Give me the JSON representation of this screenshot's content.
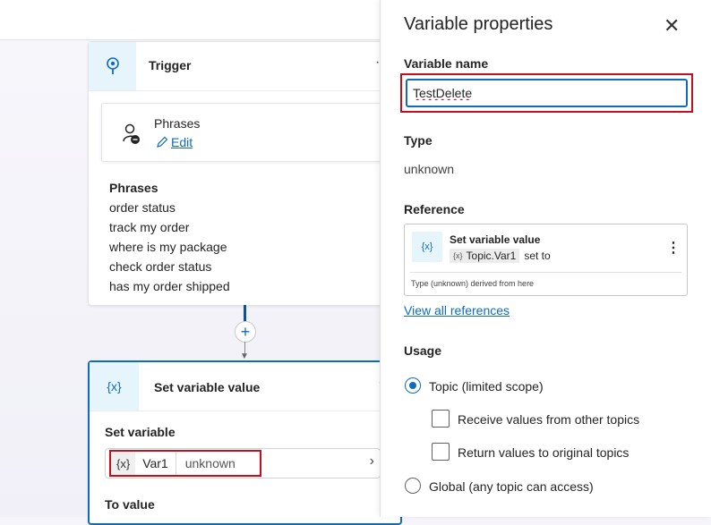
{
  "canvas": {
    "trigger": {
      "title": "Trigger",
      "more": "···",
      "phrases_box": {
        "title": "Phrases",
        "edit_label": "Edit"
      },
      "phrases_title": "Phrases",
      "phrases": [
        "order status",
        "track my order",
        "where is my package",
        "check order status",
        "has my order shipped"
      ]
    },
    "add_node": "+",
    "set_variable": {
      "icon": "{x}",
      "title": "Set variable value",
      "more": "···",
      "set_label": "Set variable",
      "variable": {
        "icon": "{x}",
        "name": "Var1",
        "type": "unknown"
      },
      "to_value_label": "To value"
    }
  },
  "panel": {
    "title": "Variable properties",
    "close": "✕",
    "name_label": "Variable name",
    "name_value": "TestDelete",
    "type_label": "Type",
    "type_value": "unknown",
    "reference_label": "Reference",
    "reference": {
      "icon": "{x}",
      "title": "Set variable value",
      "chip_icon": "{x}",
      "chip_text": "Topic.Var1",
      "set_to": "set to",
      "footer": "Type (unknown) derived from here",
      "more": "⋮"
    },
    "view_all": "View all references",
    "usage_label": "Usage",
    "usage": {
      "topic": "Topic (limited scope)",
      "receive": "Receive values from other topics",
      "return": "Return values to original topics",
      "global": "Global (any topic can access)",
      "selected": "topic"
    }
  },
  "colors": {
    "accent": "#0f6cbd",
    "highlight": "#c50f1f",
    "icon_bg": "#e6f4fb"
  }
}
